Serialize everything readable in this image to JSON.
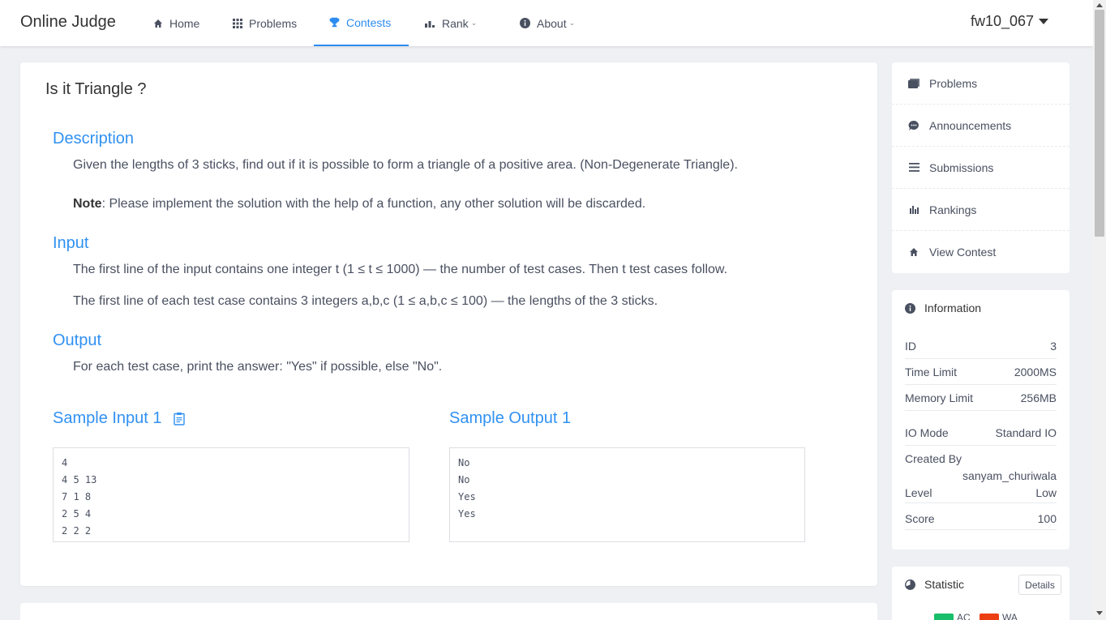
{
  "nav": {
    "brand": "Online Judge",
    "items": [
      {
        "label": "Home",
        "icon": "home-icon"
      },
      {
        "label": "Problems",
        "icon": "grid-icon"
      },
      {
        "label": "Contests",
        "icon": "trophy-icon"
      },
      {
        "label": "Rank",
        "icon": "bar-chart-icon"
      },
      {
        "label": "About",
        "icon": "info-icon"
      }
    ],
    "active": "Contests",
    "user": "fw10_067"
  },
  "problem": {
    "title": "Is it Triangle ?",
    "description_title": "Description",
    "description": "Given the lengths of 3 sticks, find out if it is possible to form a triangle of a positive area. (Non-Degenerate Triangle).",
    "note_label": "Note",
    "note": ": Please implement the solution with the help of a function, any other solution will be discarded.",
    "input_title": "Input",
    "input_1": "The first line of the input contains one integer t (1 ≤ t ≤ 1000) — the number of test cases. Then t test cases follow.",
    "input_2": "The first line of each test case contains 3 integers a,b,c (1 ≤ a,b,c ≤ 100) — the lengths of the 3 sticks.",
    "output_title": "Output",
    "output": "For each test case, print the answer: \"Yes\" if possible, else \"No\".",
    "sample_input_title": "Sample Input 1",
    "sample_output_title": "Sample Output 1",
    "sample_input": [
      "4",
      "4 5 13",
      "7 1 8",
      "2 5 4",
      "2 2 2"
    ],
    "sample_output": [
      "No",
      "No",
      "Yes",
      "Yes"
    ]
  },
  "sidebar": {
    "menu": [
      {
        "label": "Problems",
        "icon": "problems-icon"
      },
      {
        "label": "Announcements",
        "icon": "chat-icon"
      },
      {
        "label": "Submissions",
        "icon": "list-icon"
      },
      {
        "label": "Rankings",
        "icon": "bar-chart-icon"
      },
      {
        "label": "View Contest",
        "icon": "home-icon"
      }
    ],
    "info": {
      "title": "Information",
      "id_label": "ID",
      "id": "3",
      "time_label": "Time Limit",
      "time": "2000MS",
      "memory_label": "Memory Limit",
      "memory": "256MB",
      "io_label": "IO Mode",
      "io": "Standard IO",
      "created_label": "Created By",
      "created": "sanyam_churiwala",
      "level_label": "Level",
      "level": "Low",
      "score_label": "Score",
      "score": "100"
    },
    "stat": {
      "title": "Statistic",
      "details": "Details",
      "legend": [
        {
          "label": "AC",
          "color": "#19be6b"
        },
        {
          "label": "WA",
          "color": "#ed3f14"
        }
      ]
    }
  },
  "colors": {
    "accent": "#2d8cf0",
    "heading": "#3091f2"
  }
}
